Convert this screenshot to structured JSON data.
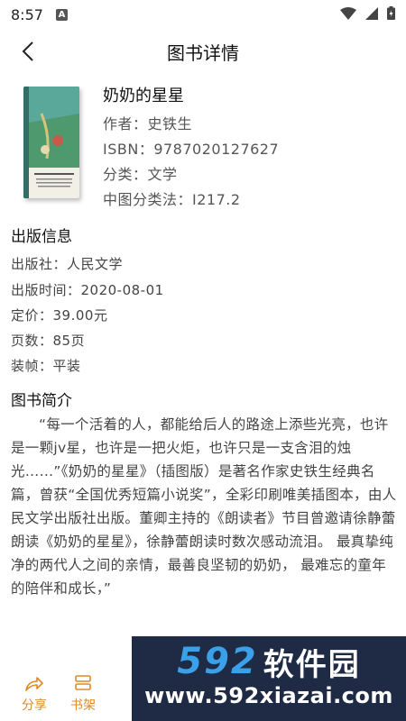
{
  "status_bar": {
    "time": "8:57",
    "notif_letter": "A"
  },
  "header": {
    "title": "图书详情"
  },
  "book": {
    "title": "奶奶的星星",
    "author": "作者：史铁生",
    "isbn": "ISBN：9787020127627",
    "category": "分类：文学",
    "clc": "中图分类法：I217.2"
  },
  "publication": {
    "section_title": "出版信息",
    "publisher": "出版社：人民文学",
    "date": "出版时间：2020-08-01",
    "price": "定价：39.00元",
    "pages": "页数：85页",
    "binding": "装帧：平装"
  },
  "introduction": {
    "section_title": "图书简介",
    "text": "“每一个活着的人，都能给后人的路途上添些光亮，也许是一颗jv星，也许是一把火炬，也许只是一支含泪的烛光……”《奶奶的星星》（插图版）是著名作家史铁生经典名篇，曾获“全国优秀短篇小说奖”，全彩印刷唯美插图本，由人民文学出版社出版。董卿主持的《朗读者》节目曾邀请徐静蕾朗读《奶奶的星星》，徐静蕾朗读时数次感动流泪。 最真挚纯净的两代人之间的亲情，最善良坚韧的奶奶， 最难忘的童年的陪伴和成长，”"
  },
  "bottom_bar": {
    "share_label": "分享",
    "shelf_label": "书架",
    "accent_color": "#d98b2a"
  },
  "watermark": {
    "number": "592",
    "chinese": "软件园",
    "url": "www.592xiazai.com"
  }
}
